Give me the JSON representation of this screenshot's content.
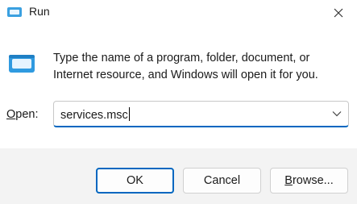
{
  "window": {
    "title": "Run",
    "title_icon": "run-app-icon",
    "close_icon": "close-icon"
  },
  "main": {
    "icon": "run-app-icon",
    "description": "Type the name of a program, folder, document, or Internet resource, and Windows will open it for you.",
    "open_label_prefix": "O",
    "open_label_rest": "pen:",
    "input_value": "services.msc",
    "dropdown_icon": "chevron-down-icon"
  },
  "buttons": {
    "ok": "OK",
    "cancel": "Cancel",
    "browse_prefix": "B",
    "browse_rest": "rowse..."
  },
  "colors": {
    "accent": "#0067c0",
    "dialog_bg": "#ffffff",
    "footer_bg": "#f3f3f3"
  }
}
